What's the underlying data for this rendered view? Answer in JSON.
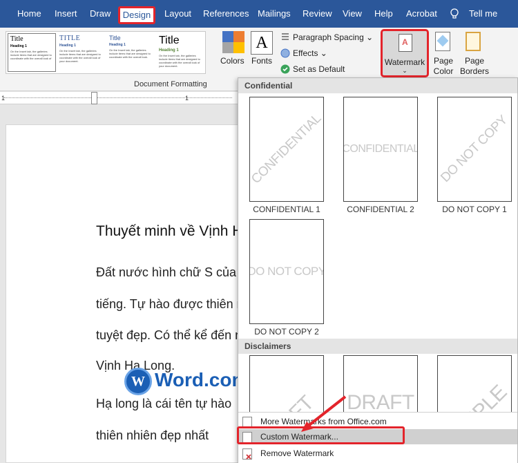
{
  "tabs": [
    {
      "label": "Home"
    },
    {
      "label": "Insert"
    },
    {
      "label": "Draw"
    },
    {
      "label": "Design"
    },
    {
      "label": "Layout"
    },
    {
      "label": "References"
    },
    {
      "label": "Mailings"
    },
    {
      "label": "Review"
    },
    {
      "label": "View"
    },
    {
      "label": "Help"
    },
    {
      "label": "Acrobat"
    },
    {
      "label": "Tell me"
    }
  ],
  "ribbon": {
    "style_thumbs": [
      {
        "title": "Title",
        "heading": "Heading 1",
        "text": "On the Insert tab, the galleries include items that are designed to coordinate with the overall look of"
      },
      {
        "title": "TITLE",
        "heading": "Heading 1",
        "text": "On the Insert tab, the galleries include items that are designed to coordinate with the overall look of your document."
      },
      {
        "title": "Title",
        "heading": "Heading 1",
        "text": "On the Insert tab, the galleries include items that are designed to coordinate with the overall look."
      },
      {
        "title": "Title",
        "heading": "Heading 1",
        "text": "On the Insert tab, the galleries include items that are designed to coordinate with the overall look of your document."
      }
    ],
    "group_label": "Document Formatting",
    "colors_label": "Colors",
    "fonts_label": "Fonts",
    "fonts_glyph": "A",
    "paragraph_spacing": "Paragraph Spacing",
    "effects": "Effects",
    "set_default": "Set as Default",
    "watermark": "Watermark",
    "page_color": "Page Color",
    "page_borders": "Page Borders"
  },
  "ruler": {
    "marks": [
      "1",
      "1"
    ]
  },
  "document": {
    "title": "Thuyết minh về Vịnh Hạ Long",
    "lines": [
      "Đất nước hình chữ S của chúng ta",
      "tiếng. Tự hào được thiên nhiên ưu đãi",
      "tuyệt đẹp. Có thể kể đến như",
      "Vịnh Hạ Long.",
      "Hạ long là cái tên tự hào",
      "thiên nhiên đẹp nhất"
    ]
  },
  "logo": {
    "letter": "W",
    "text": "Word.com.vn"
  },
  "gallery": {
    "sections": [
      {
        "heading": "Confidential",
        "items": [
          {
            "text": "CONFIDENTIAL",
            "caption": "CONFIDENTIAL 1"
          },
          {
            "text": "CONFIDENTIAL",
            "caption": "CONFIDENTIAL 2"
          },
          {
            "text": "DO NOT COPY",
            "caption": "DO NOT COPY 1"
          },
          {
            "text": "DO NOT COPY",
            "caption": "DO NOT COPY 2"
          }
        ]
      },
      {
        "heading": "Disclaimers",
        "items": [
          {
            "text": "DRAFT",
            "caption": ""
          },
          {
            "text": "DRAFT",
            "caption": ""
          },
          {
            "text": "SAMPLE",
            "caption": ""
          }
        ]
      }
    ],
    "menu": [
      {
        "label": "More Watermarks from Office.com"
      },
      {
        "label": "Custom Watermark..."
      },
      {
        "label": "Remove Watermark"
      }
    ]
  },
  "colors": {
    "accent": "#2b579a",
    "highlight": "#e3242b",
    "logo_blue": "#1b5fb5"
  }
}
